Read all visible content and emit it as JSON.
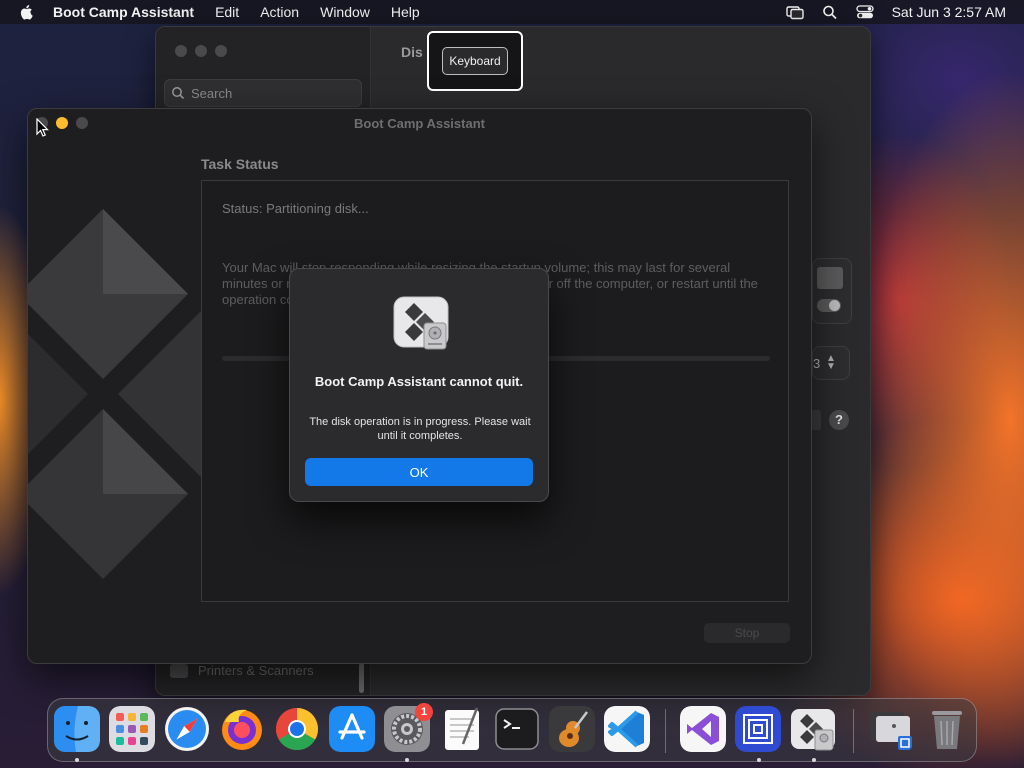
{
  "menubar": {
    "app_name": "Boot Camp Assistant",
    "items": [
      "Edit",
      "Action",
      "Window",
      "Help"
    ],
    "clock": "Sat Jun 3  2:57 AM"
  },
  "tooltip": {
    "label": "Keyboard"
  },
  "settings_window": {
    "search_placeholder": "Search",
    "main_title": "Dis",
    "sidebar_item": "Printers & Scanners",
    "stepper_value": "3",
    "help": "?"
  },
  "bootcamp": {
    "title": "Boot Camp Assistant",
    "heading": "Task Status",
    "status": "Status: Partitioning disk...",
    "description": "Your Mac will stop responding while resizing the startup volume; this may last for several minutes or more. Do not quit Boot Camp Assistant, power off the computer, or restart until the operation completes.",
    "stop_label": "Stop"
  },
  "alert": {
    "title": "Boot Camp Assistant cannot quit.",
    "message": "The disk operation is in progress. Please wait until it completes.",
    "ok_label": "OK"
  },
  "dock": {
    "apps": [
      "Finder",
      "Launchpad",
      "Safari",
      "Firefox",
      "Google Chrome",
      "App Store",
      "System Settings",
      "TextEdit",
      "Terminal",
      "GarageBand",
      "Visual Studio Code",
      "Visual Studio",
      "Parallels",
      "Boot Camp Assistant",
      "Downloads",
      "Trash"
    ],
    "settings_badge": "1"
  },
  "colors": {
    "accent": "#1479e8",
    "badge": "#f2453d",
    "traffic_red": "#ff5f57",
    "traffic_yellow": "#febc2e"
  }
}
